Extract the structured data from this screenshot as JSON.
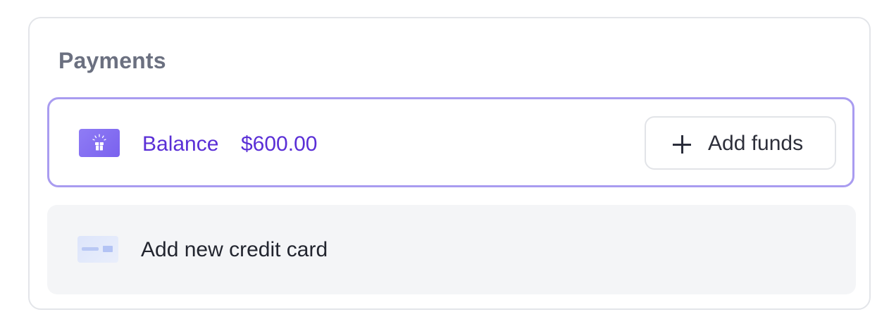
{
  "payments": {
    "title": "Payments",
    "balance": {
      "label": "Balance",
      "amount": "$600.00",
      "icon": "gift-icon",
      "add_funds_label": "Add funds",
      "add_funds_icon": "plus-icon"
    },
    "credit_card": {
      "label": "Add new credit card",
      "icon": "credit-card-icon"
    }
  },
  "colors": {
    "accent": "#5a2fd6",
    "selected_border": "#a99cf0",
    "muted_row_bg": "#f4f5f7"
  }
}
